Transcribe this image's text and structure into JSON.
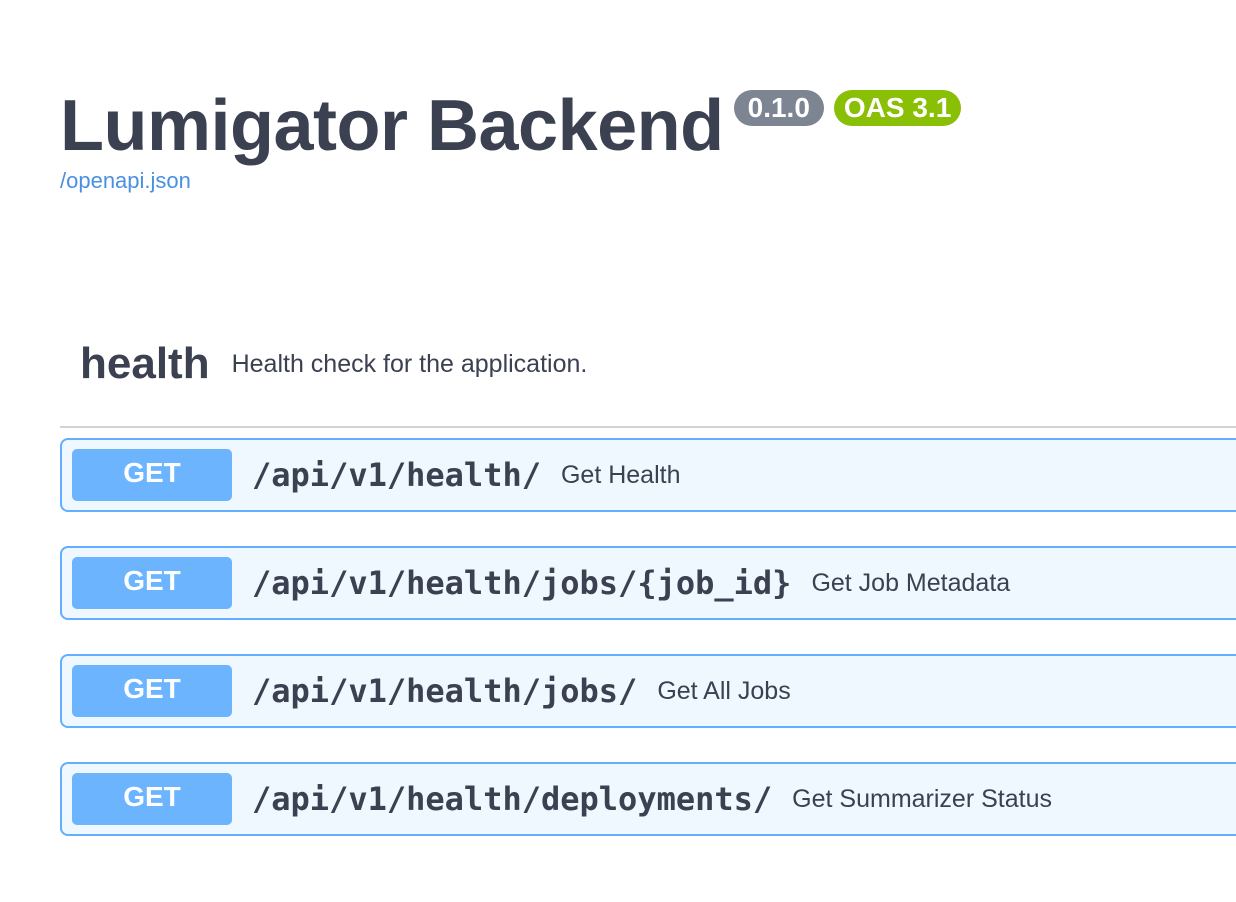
{
  "info": {
    "title": "Lumigator Backend",
    "version": "0.1.0",
    "oas_version": "OAS 3.1",
    "spec_link": "/openapi.json"
  },
  "tag": {
    "name": "health",
    "description": "Health check for the application."
  },
  "operations": [
    {
      "method": "GET",
      "path": "/api/v1/health/",
      "summary": "Get Health"
    },
    {
      "method": "GET",
      "path": "/api/v1/health/jobs/{job_id}",
      "summary": "Get Job Metadata"
    },
    {
      "method": "GET",
      "path": "/api/v1/health/jobs/",
      "summary": "Get All Jobs"
    },
    {
      "method": "GET",
      "path": "/api/v1/health/deployments/",
      "summary": "Get Summarizer Status"
    }
  ],
  "colors": {
    "get_method": "#61affe",
    "version_badge": "#7d8492",
    "oas_badge": "#89bf04",
    "link": "#4990e2",
    "text": "#3b4151"
  }
}
